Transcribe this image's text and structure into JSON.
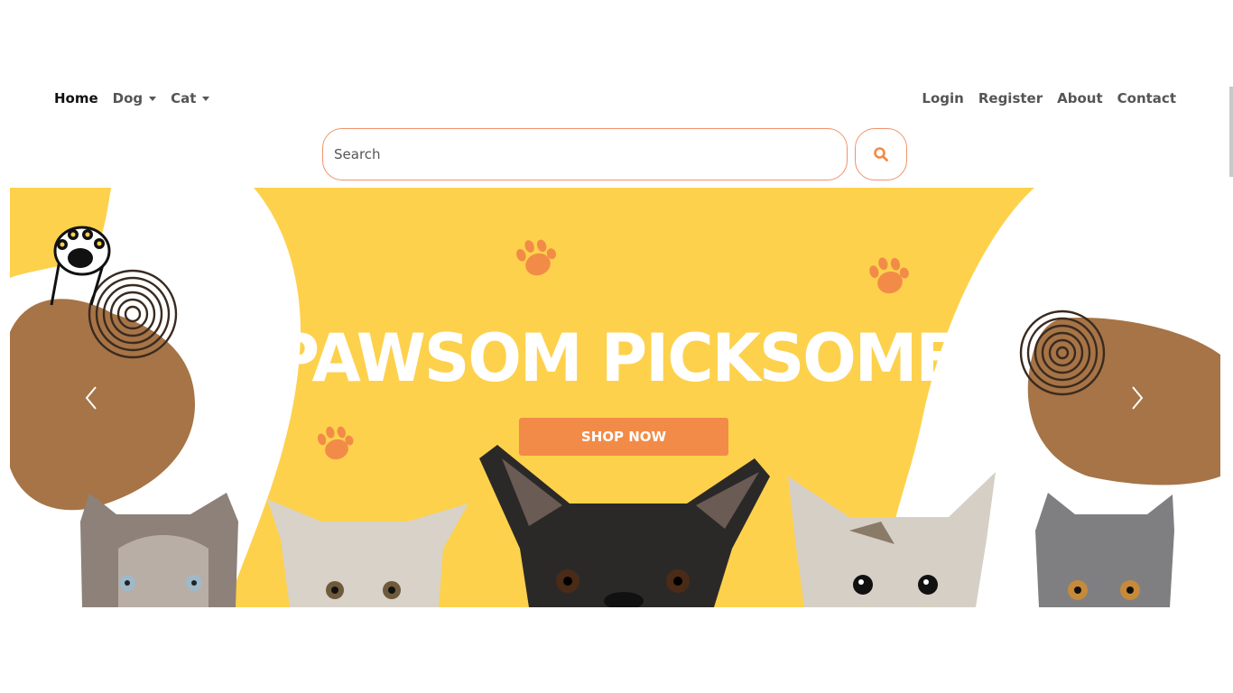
{
  "nav": {
    "left": [
      {
        "label": "Home",
        "active": true,
        "dropdown": false
      },
      {
        "label": "Dog",
        "active": false,
        "dropdown": true
      },
      {
        "label": "Cat",
        "active": false,
        "dropdown": true
      }
    ],
    "right": [
      {
        "label": "Login"
      },
      {
        "label": "Register"
      },
      {
        "label": "About"
      },
      {
        "label": "Contact"
      }
    ]
  },
  "search": {
    "placeholder": "Search",
    "value": "",
    "button_icon": "search-icon"
  },
  "hero": {
    "title": "Pawsom Picksome",
    "button_label": "Shop Now",
    "prev_icon": "chevron-left-icon",
    "next_icon": "chevron-right-icon"
  },
  "colors": {
    "accent": "#f28b48",
    "banner_yellow": "#fdd14c",
    "blob_brown": "#a67446",
    "border": "#f0926b"
  }
}
